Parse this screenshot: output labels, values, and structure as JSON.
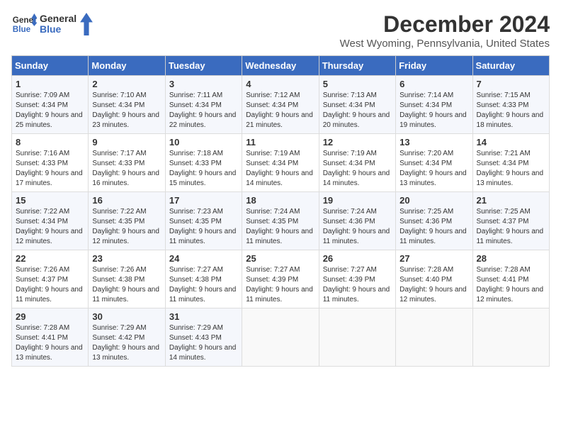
{
  "header": {
    "logo_line1": "General",
    "logo_line2": "Blue",
    "month_title": "December 2024",
    "subtitle": "West Wyoming, Pennsylvania, United States"
  },
  "days_of_week": [
    "Sunday",
    "Monday",
    "Tuesday",
    "Wednesday",
    "Thursday",
    "Friday",
    "Saturday"
  ],
  "weeks": [
    [
      {
        "day": "1",
        "sunrise": "7:09 AM",
        "sunset": "4:34 PM",
        "daylight": "9 hours and 25 minutes."
      },
      {
        "day": "2",
        "sunrise": "7:10 AM",
        "sunset": "4:34 PM",
        "daylight": "9 hours and 23 minutes."
      },
      {
        "day": "3",
        "sunrise": "7:11 AM",
        "sunset": "4:34 PM",
        "daylight": "9 hours and 22 minutes."
      },
      {
        "day": "4",
        "sunrise": "7:12 AM",
        "sunset": "4:34 PM",
        "daylight": "9 hours and 21 minutes."
      },
      {
        "day": "5",
        "sunrise": "7:13 AM",
        "sunset": "4:34 PM",
        "daylight": "9 hours and 20 minutes."
      },
      {
        "day": "6",
        "sunrise": "7:14 AM",
        "sunset": "4:34 PM",
        "daylight": "9 hours and 19 minutes."
      },
      {
        "day": "7",
        "sunrise": "7:15 AM",
        "sunset": "4:33 PM",
        "daylight": "9 hours and 18 minutes."
      }
    ],
    [
      {
        "day": "8",
        "sunrise": "7:16 AM",
        "sunset": "4:33 PM",
        "daylight": "9 hours and 17 minutes."
      },
      {
        "day": "9",
        "sunrise": "7:17 AM",
        "sunset": "4:33 PM",
        "daylight": "9 hours and 16 minutes."
      },
      {
        "day": "10",
        "sunrise": "7:18 AM",
        "sunset": "4:33 PM",
        "daylight": "9 hours and 15 minutes."
      },
      {
        "day": "11",
        "sunrise": "7:19 AM",
        "sunset": "4:34 PM",
        "daylight": "9 hours and 14 minutes."
      },
      {
        "day": "12",
        "sunrise": "7:19 AM",
        "sunset": "4:34 PM",
        "daylight": "9 hours and 14 minutes."
      },
      {
        "day": "13",
        "sunrise": "7:20 AM",
        "sunset": "4:34 PM",
        "daylight": "9 hours and 13 minutes."
      },
      {
        "day": "14",
        "sunrise": "7:21 AM",
        "sunset": "4:34 PM",
        "daylight": "9 hours and 13 minutes."
      }
    ],
    [
      {
        "day": "15",
        "sunrise": "7:22 AM",
        "sunset": "4:34 PM",
        "daylight": "9 hours and 12 minutes."
      },
      {
        "day": "16",
        "sunrise": "7:22 AM",
        "sunset": "4:35 PM",
        "daylight": "9 hours and 12 minutes."
      },
      {
        "day": "17",
        "sunrise": "7:23 AM",
        "sunset": "4:35 PM",
        "daylight": "9 hours and 11 minutes."
      },
      {
        "day": "18",
        "sunrise": "7:24 AM",
        "sunset": "4:35 PM",
        "daylight": "9 hours and 11 minutes."
      },
      {
        "day": "19",
        "sunrise": "7:24 AM",
        "sunset": "4:36 PM",
        "daylight": "9 hours and 11 minutes."
      },
      {
        "day": "20",
        "sunrise": "7:25 AM",
        "sunset": "4:36 PM",
        "daylight": "9 hours and 11 minutes."
      },
      {
        "day": "21",
        "sunrise": "7:25 AM",
        "sunset": "4:37 PM",
        "daylight": "9 hours and 11 minutes."
      }
    ],
    [
      {
        "day": "22",
        "sunrise": "7:26 AM",
        "sunset": "4:37 PM",
        "daylight": "9 hours and 11 minutes."
      },
      {
        "day": "23",
        "sunrise": "7:26 AM",
        "sunset": "4:38 PM",
        "daylight": "9 hours and 11 minutes."
      },
      {
        "day": "24",
        "sunrise": "7:27 AM",
        "sunset": "4:38 PM",
        "daylight": "9 hours and 11 minutes."
      },
      {
        "day": "25",
        "sunrise": "7:27 AM",
        "sunset": "4:39 PM",
        "daylight": "9 hours and 11 minutes."
      },
      {
        "day": "26",
        "sunrise": "7:27 AM",
        "sunset": "4:39 PM",
        "daylight": "9 hours and 11 minutes."
      },
      {
        "day": "27",
        "sunrise": "7:28 AM",
        "sunset": "4:40 PM",
        "daylight": "9 hours and 12 minutes."
      },
      {
        "day": "28",
        "sunrise": "7:28 AM",
        "sunset": "4:41 PM",
        "daylight": "9 hours and 12 minutes."
      }
    ],
    [
      {
        "day": "29",
        "sunrise": "7:28 AM",
        "sunset": "4:41 PM",
        "daylight": "9 hours and 13 minutes."
      },
      {
        "day": "30",
        "sunrise": "7:29 AM",
        "sunset": "4:42 PM",
        "daylight": "9 hours and 13 minutes."
      },
      {
        "day": "31",
        "sunrise": "7:29 AM",
        "sunset": "4:43 PM",
        "daylight": "9 hours and 14 minutes."
      },
      null,
      null,
      null,
      null
    ]
  ],
  "labels": {
    "sunrise": "Sunrise:",
    "sunset": "Sunset:",
    "daylight": "Daylight:"
  }
}
